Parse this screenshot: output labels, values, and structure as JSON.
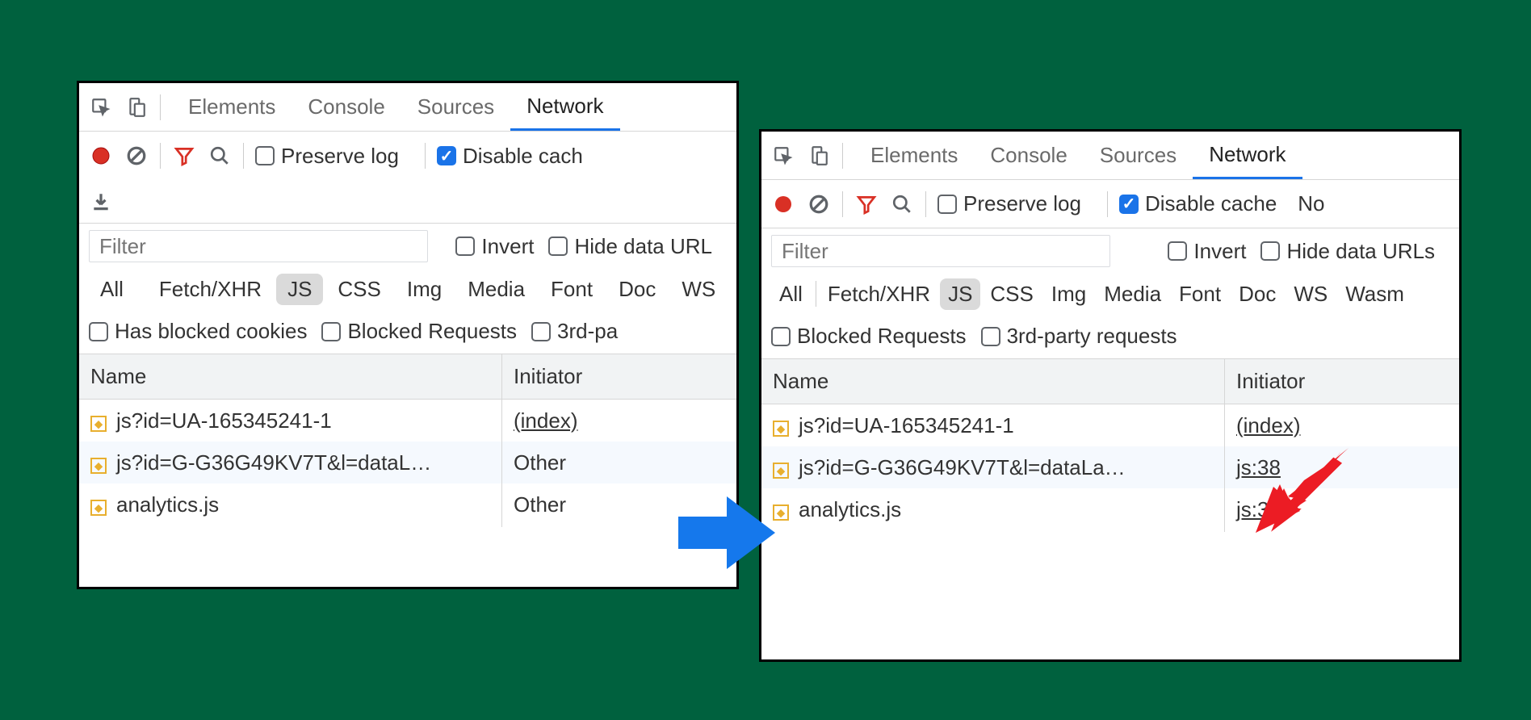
{
  "tabs": [
    "Elements",
    "Console",
    "Sources",
    "Network"
  ],
  "active_tab": "Network",
  "toolbar": {
    "preserve_log": "Preserve log",
    "disable_cache": "Disable cache",
    "disable_partial_right": "Disable cach",
    "no_throttling_partial": "No"
  },
  "filter": {
    "placeholder": "Filter",
    "invert": "Invert",
    "hide_urls": "Hide data URLs",
    "hide_urls_partial_left": "Hide data URL"
  },
  "types": [
    "All",
    "Fetch/XHR",
    "JS",
    "CSS",
    "Img",
    "Media",
    "Font",
    "Doc",
    "WS",
    "Wasm"
  ],
  "active_type": "JS",
  "extra": {
    "blocked_cookies": "Has blocked cookies",
    "blocked_requests": "Blocked Requests",
    "third_party": "3rd-party requests",
    "third_party_partial_left": "3rd-pa"
  },
  "columns": {
    "name": "Name",
    "initiator": "Initiator"
  },
  "left_rows": [
    {
      "name": "js?id=UA-165345241-1",
      "initiator": "(index)",
      "link": true
    },
    {
      "name": "js?id=G-G36G49KV7T&l=dataL…",
      "initiator": "Other",
      "link": false
    },
    {
      "name": "analytics.js",
      "initiator": "Other",
      "link": false
    }
  ],
  "right_rows": [
    {
      "name": "js?id=UA-165345241-1",
      "initiator": "(index)",
      "link": true
    },
    {
      "name": "js?id=G-G36G49KV7T&l=dataLa…",
      "initiator": "js:38",
      "link": true
    },
    {
      "name": "analytics.js",
      "initiator": "js:38",
      "link": true
    }
  ]
}
